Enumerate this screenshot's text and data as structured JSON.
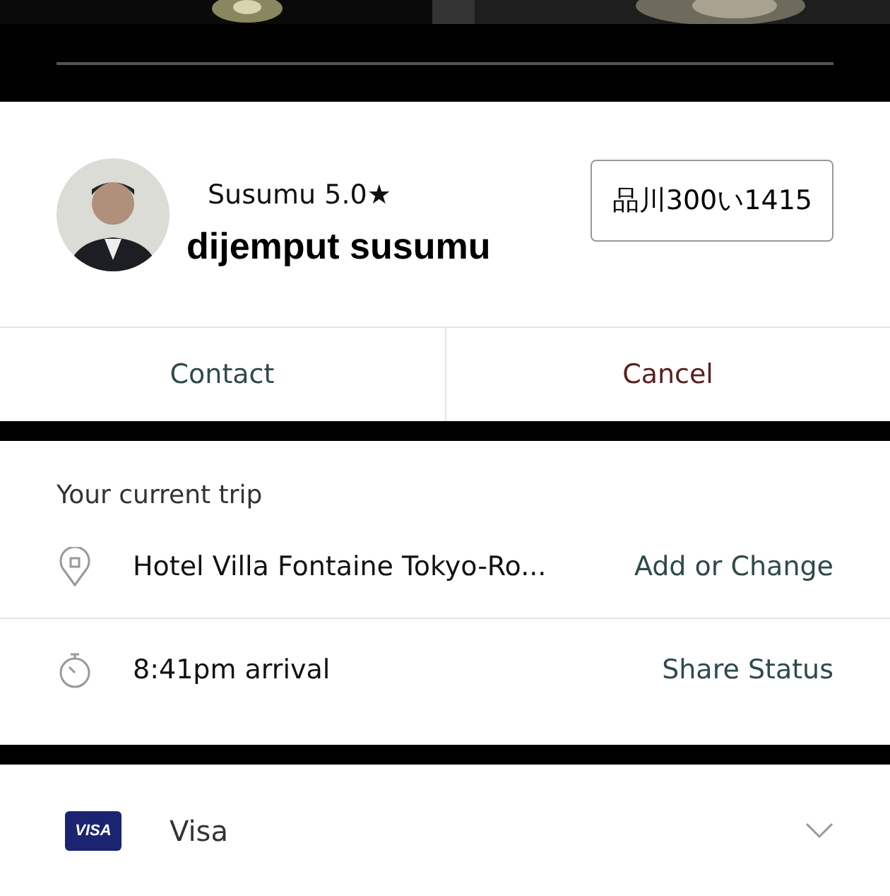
{
  "driver": {
    "name": "Susumu",
    "rating": "5.0★",
    "status": "dijemput susumu",
    "plate": "品川300い1415"
  },
  "actions": [
    {
      "label": "Contact",
      "kind": "contact"
    },
    {
      "label": "Cancel",
      "kind": "cancel"
    }
  ],
  "trip": {
    "heading": "Your current trip",
    "rows": [
      {
        "kind": "destination",
        "text": "Hotel Villa Fontaine Tokyo-Ro...",
        "action": "Add or Change"
      },
      {
        "kind": "arrival",
        "text": "8:41pm arrival",
        "action": "Share Status"
      }
    ]
  },
  "payment": {
    "card_logo": "VISA",
    "label": "Visa"
  }
}
